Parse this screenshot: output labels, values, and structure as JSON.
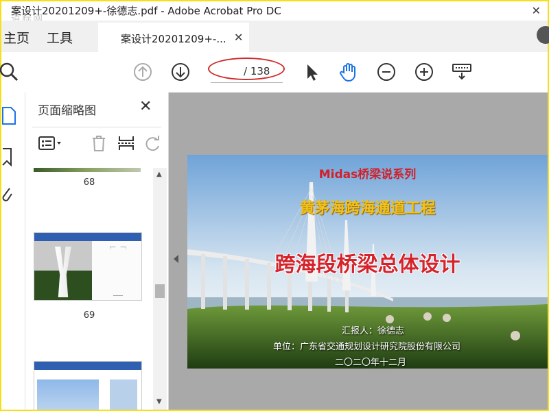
{
  "window": {
    "title": "案设计20201209+-徐德志.pdf - Adobe Acrobat Pro DC",
    "watermark": "道标网"
  },
  "tabs": {
    "home": "主页",
    "tools": "工具",
    "document": "案设计20201209+-..."
  },
  "toolbar": {
    "current_page": "",
    "page_total": "/ 138",
    "icons": [
      "search-icon",
      "page-up-icon",
      "page-down-icon",
      "select-cursor-icon",
      "hand-tool-icon",
      "zoom-out-icon",
      "zoom-in-icon",
      "keyboard-icon"
    ]
  },
  "thumbnail_panel": {
    "title": "页面缩略图",
    "pages": [
      "68",
      "69"
    ]
  },
  "slide": {
    "series": "Midas桥梁说系列",
    "project": "黄茅海跨海通道工程",
    "main_title": "跨海段桥梁总体设计",
    "reporter": "汇报人：徐德志",
    "unit": "单位：广东省交通规划设计研究院股份有限公司",
    "date": "二〇二〇年十二月"
  },
  "colors": {
    "frame": "#f7df16",
    "hand_tool_active": "#1b73e8",
    "annotation_red": "#cf2a2a"
  }
}
